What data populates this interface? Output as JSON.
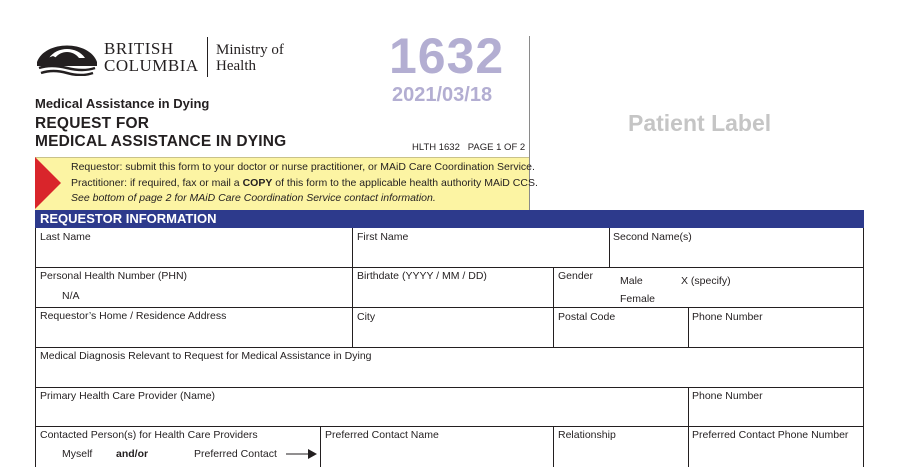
{
  "header": {
    "logo": {
      "line1": "BRITISH",
      "line2": "COLUMBIA",
      "ministry_line1": "Ministry of",
      "ministry_line2": "Health"
    },
    "form_number": "1632",
    "form_date": "2021/03/18",
    "subtitle": "Medical Assistance in Dying",
    "title_line1": "REQUEST FOR",
    "title_line2": "MEDICAL ASSISTANCE IN DYING",
    "form_code": "HLTH 1632   PAGE 1 OF 2",
    "patient_label": "Patient Label"
  },
  "notice": {
    "line1": "Requestor: submit this form to your doctor or nurse practitioner, or MAiD Care Coordination Service.",
    "line2_pre": "Practitioner: if required, fax or mail a ",
    "line2_bold": "COPY",
    "line2_post": " of this form to the applicable health authority MAiD CCS.",
    "line3": "See bottom of page 2 for MAiD Care Coordination Service contact information."
  },
  "section": {
    "title": "REQUESTOR INFORMATION"
  },
  "fields": {
    "last_name": "Last Name",
    "first_name": "First Name",
    "second_names": "Second Name(s)",
    "phn": "Personal Health Number (PHN)",
    "phn_value": "N/A",
    "birthdate": "Birthdate (YYYY / MM / DD)",
    "gender": "Gender",
    "gender_male": "Male",
    "gender_female": "Female",
    "gender_x": "X (specify)",
    "address": "Requestor’s Home / Residence Address",
    "city": "City",
    "postal_code": "Postal Code",
    "phone_number": "Phone Number",
    "diagnosis": "Medical Diagnosis Relevant to Request for Medical Assistance in Dying",
    "primary_provider": "Primary Health Care Provider (Name)",
    "provider_phone": "Phone Number",
    "contacted_persons": "Contacted Person(s) for Health Care Providers",
    "myself": "Myself",
    "and_or": "and/or",
    "preferred_contact": "Preferred Contact",
    "preferred_contact_name": "Preferred Contact Name",
    "relationship": "Relationship",
    "preferred_contact_phone": "Preferred Contact Phone Number"
  },
  "colors": {
    "section_bar": "#2d3a8c",
    "notice_bg": "#fcf4a3",
    "notice_arrow": "#d9252b",
    "form_number": "#b3aed2"
  }
}
